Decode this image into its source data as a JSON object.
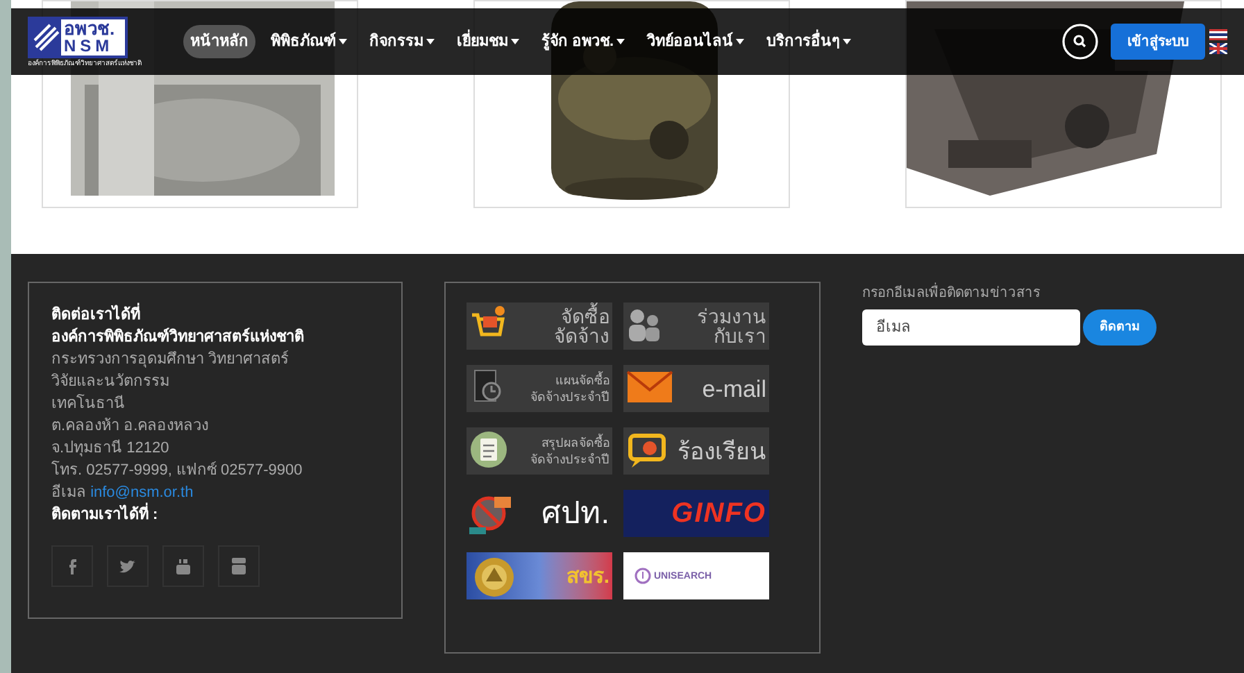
{
  "nav": {
    "logo": {
      "abbr": "อพวช.",
      "latin": "NSM",
      "caption": "องค์การพิพิธภัณฑ์วิทยาศาสตร์แห่งชาติ"
    },
    "menu": [
      {
        "label": "หน้าหลัก",
        "selected": true,
        "dropdown": false
      },
      {
        "label": "พิพิธภัณฑ์",
        "selected": false,
        "dropdown": true
      },
      {
        "label": "กิจกรรม",
        "selected": false,
        "dropdown": true
      },
      {
        "label": "เยี่ยมชม",
        "selected": false,
        "dropdown": true
      },
      {
        "label": "รู้จัก อพวช.",
        "selected": false,
        "dropdown": true
      },
      {
        "label": "วิทย์ออนไลน์",
        "selected": false,
        "dropdown": true
      },
      {
        "label": "บริการอื่นๆ",
        "selected": false,
        "dropdown": true
      }
    ],
    "login": "เข้าสู่ระบบ"
  },
  "footer": {
    "contact": {
      "heading": "ติดต่อเราได้ที่",
      "org": "องค์การพิพิธภัณฑ์วิทยาศาสตร์แห่งชาติ",
      "lines": [
        "กระทรวงการอุดมศึกษา วิทยาศาสตร์",
        "วิจัยและนวัตกรรม",
        "เทคโนธานี",
        "ต.คลองห้า อ.คลองหลวง",
        "จ.ปทุมธานี 12120",
        "โทร. 02577-9999, แฟกซ์ 02577-9900"
      ],
      "email_label": "อีเมล",
      "email": "info@nsm.or.th",
      "follow": "ติดตามเราได้ที่ :"
    },
    "banners": [
      {
        "kind": "cart",
        "lines": [
          "จัดซื้อ",
          "จัดจ้าง"
        ]
      },
      {
        "kind": "people",
        "lines": [
          "ร่วมงาน",
          "กับเรา"
        ]
      },
      {
        "kind": "document",
        "lines": [
          "แผนจัดซื้อ",
          "จัดจ้างประจำปี"
        ]
      },
      {
        "kind": "mail",
        "lines": [
          "e-mail"
        ]
      },
      {
        "kind": "clipboard",
        "lines": [
          "สรุปผลจัดซื้อ",
          "จัดจ้างประจำปี"
        ]
      },
      {
        "kind": "chat",
        "lines": [
          "ร้องเรียน"
        ]
      },
      {
        "kind": "anti",
        "lines": [
          "ศปท."
        ]
      },
      {
        "kind": "ginfo",
        "lines": [
          "GINFO"
        ]
      },
      {
        "kind": "seal",
        "lines": [
          "สขร."
        ]
      },
      {
        "kind": "unisearch",
        "lines": [
          "UNISEARCH"
        ]
      }
    ],
    "newsletter": {
      "label": "กรอกอีเมลเพื่อติดตามข่าวสาร",
      "placeholder": "อีเมล",
      "button": "ติดตาม"
    }
  }
}
